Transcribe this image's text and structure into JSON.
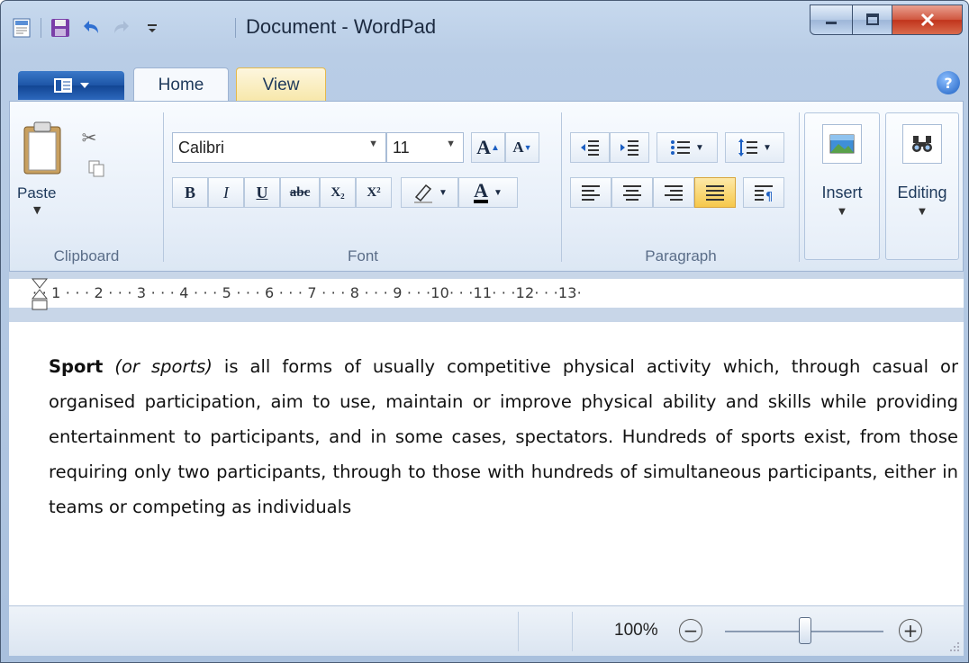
{
  "window": {
    "title": "Document - WordPad"
  },
  "tabs": {
    "home": "Home",
    "view": "View"
  },
  "clipboard": {
    "paste_label": "Paste",
    "group_label": "Clipboard"
  },
  "font": {
    "family": "Calibri",
    "size": "11",
    "group_label": "Font",
    "bold": "B",
    "italic": "I",
    "underline": "U",
    "strikethrough": "abc",
    "subscript": "X₂",
    "superscript": "X²",
    "grow": "A",
    "shrink": "A",
    "color": "A"
  },
  "paragraph": {
    "group_label": "Paragraph"
  },
  "insert": {
    "label": "Insert"
  },
  "editing": {
    "label": "Editing"
  },
  "ruler": {
    "text": "· · 1 · · · 2 · · · 3 · · · 4 · · · 5 · · · 6 · · · 7 · · · 8 · · · 9 · · ·10· · ·11· · ·12· · ·13·"
  },
  "document": {
    "bold_lead": "Sport",
    "italic_part": "(or sports)",
    "body": " is all forms of usually competitive physical activity which, through casual or organised participation, aim to use, maintain or improve physical ability and skills while providing entertainment to participants, and in some cases, spectators. Hundreds of sports exist, from those requiring only two participants, through to those with hundreds of simultaneous participants, either in teams or competing as individuals"
  },
  "status": {
    "zoom": "100%",
    "zoom_level_percent": 100,
    "zoom_out": "−",
    "zoom_in": "+"
  },
  "colors": {
    "accent": "#1d55a7",
    "active_button": "#f6c84b",
    "close_button": "#c1341c"
  }
}
